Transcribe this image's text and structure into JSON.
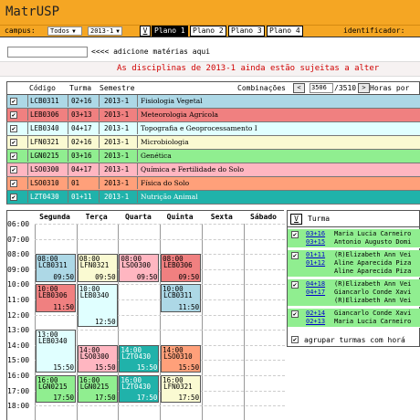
{
  "app": {
    "title": "MatrUSP"
  },
  "nav": {
    "campus_label": "campus:",
    "campus_value": "Todos",
    "semester_value": "2013-1",
    "plan_v": "V",
    "plans": [
      "Plano 1",
      "Plano 2",
      "Plano 3",
      "Plano 4"
    ],
    "identifier_label": "identificador:"
  },
  "add": {
    "hint": "<<<< adicione matérias aqui"
  },
  "warning": "As disciplinas de 2013-1 ainda estão sujeitas a alter",
  "course_table": {
    "headers": {
      "code": "Código",
      "turma": "Turma",
      "semester": "Semestre"
    },
    "combinations_label": "Combinações",
    "prev_label": "<",
    "next_label": ">",
    "combination_current": "3506",
    "combination_total": "/3510",
    "hours_label": "Horas por",
    "rows": [
      {
        "check": "✔",
        "code": "LCB0311",
        "turma": "02+16",
        "semester": "2013-1",
        "name": "Fisiologia Vegetal",
        "color": "#add8e6",
        "dark": false
      },
      {
        "check": "✔",
        "code": "LEB0306",
        "turma": "03+13",
        "semester": "2013-1",
        "name": "Meteorologia Agrícola",
        "color": "#f08080",
        "dark": false
      },
      {
        "check": "✔",
        "code": "LEB0340",
        "turma": "04+17",
        "semester": "2013-1",
        "name": "Topografia e Geoprocessamento I",
        "color": "#e0ffff",
        "dark": false
      },
      {
        "check": "✔",
        "code": "LFN0321",
        "turma": "02+16",
        "semester": "2013-1",
        "name": "Microbiologia",
        "color": "#fafad2",
        "dark": false
      },
      {
        "check": "✔",
        "code": "LGN0215",
        "turma": "03+16",
        "semester": "2013-1",
        "name": "Genética",
        "color": "#90ee90",
        "dark": false
      },
      {
        "check": "✔",
        "code": "LSO0300",
        "turma": "04+17",
        "semester": "2013-1",
        "name": "Química e Fertilidade do Solo",
        "color": "#ffb6c1",
        "dark": false
      },
      {
        "check": "✔",
        "code": "LSO0310",
        "turma": "01",
        "semester": "2013-1",
        "name": "Física do Solo",
        "color": "#ffa07a",
        "dark": false
      },
      {
        "check": "✔",
        "code": "LZT0430",
        "turma": "01+11",
        "semester": "2013-1",
        "name": "Nutrição Animal",
        "color": "#20b2aa",
        "dark": true
      }
    ]
  },
  "calendar": {
    "days": [
      "Segunda",
      "Terça",
      "Quarta",
      "Quinta",
      "Sexta",
      "Sábado"
    ],
    "times": [
      "06:00",
      "07:00",
      "08:00",
      "09:00",
      "10:00",
      "11:00",
      "12:00",
      "13:00",
      "14:00",
      "15:00",
      "16:00",
      "17:00",
      "18:00"
    ],
    "blocks": [
      {
        "day": 0,
        "start": "08:00",
        "end": "09:50",
        "code": "LCB0311",
        "color": "#add8e6",
        "dark": false
      },
      {
        "day": 1,
        "start": "08:00",
        "end": "09:50",
        "code": "LFN0321",
        "color": "#fafad2",
        "dark": false
      },
      {
        "day": 2,
        "start": "08:00",
        "end": "09:50",
        "code": "LSO0300",
        "color": "#ffb6c1",
        "dark": false
      },
      {
        "day": 3,
        "start": "08:00",
        "end": "09:50",
        "code": "LEB0306",
        "color": "#f08080",
        "dark": false
      },
      {
        "day": 0,
        "start": "10:00",
        "end": "11:50",
        "code": "LEB0306",
        "color": "#f08080",
        "dark": false
      },
      {
        "day": 1,
        "start": "10:00",
        "end": "12:50",
        "code": "LEB0340",
        "color": "#e0ffff",
        "dark": false
      },
      {
        "day": 3,
        "start": "10:00",
        "end": "11:50",
        "code": "LCB0311",
        "color": "#add8e6",
        "dark": false
      },
      {
        "day": 0,
        "start": "13:00",
        "end": "15:50",
        "code": "LEB0340",
        "color": "#e0ffff",
        "dark": false
      },
      {
        "day": 1,
        "start": "14:00",
        "end": "15:50",
        "code": "LSO0300",
        "color": "#ffb6c1",
        "dark": false
      },
      {
        "day": 2,
        "start": "14:00",
        "end": "15:50",
        "code": "LZT0430",
        "color": "#20b2aa",
        "dark": true
      },
      {
        "day": 3,
        "start": "14:00",
        "end": "15:50",
        "code": "LSO0310",
        "color": "#ffa07a",
        "dark": false
      },
      {
        "day": 0,
        "start": "16:00",
        "end": "17:50",
        "code": "LGN0215",
        "color": "#90ee90",
        "dark": false
      },
      {
        "day": 1,
        "start": "16:00",
        "end": "17:50",
        "code": "LGN0215",
        "color": "#90ee90",
        "dark": false
      },
      {
        "day": 2,
        "start": "16:00",
        "end": "17:50",
        "code": "LZT0430",
        "color": "#20b2aa",
        "dark": true
      },
      {
        "day": 3,
        "start": "16:00",
        "end": "17:50",
        "code": "LFN0321",
        "color": "#fafad2",
        "dark": false
      }
    ]
  },
  "turma_panel": {
    "v_label": "V",
    "turma_label": "Turma",
    "rows": [
      {
        "check": "✔",
        "nums": [
          "03+16",
          "03+15"
        ],
        "names": [
          "Maria Lucia Carneiro",
          "Antonio Augusto Domi"
        ]
      },
      {
        "check": "✔",
        "nums": [
          "01+11",
          "01+12"
        ],
        "names": [
          "(R)Elizabeth Ann Vei",
          "Aline Aparecida Piza",
          "Aline Aparecida Piza"
        ]
      },
      {
        "check": "✔",
        "nums": [
          "04+18",
          "04+17"
        ],
        "names": [
          "(R)Elizabeth Ann Vei",
          "Giancarlo Conde Xavi",
          "(R)Elizabeth Ann Vei"
        ]
      },
      {
        "check": "✔",
        "nums": [
          "02+14",
          "02+13"
        ],
        "names": [
          "Giancarlo Conde Xavi",
          "Maria Lucia Carneiro"
        ]
      }
    ],
    "group_label": "agrupar turmas com horá"
  }
}
